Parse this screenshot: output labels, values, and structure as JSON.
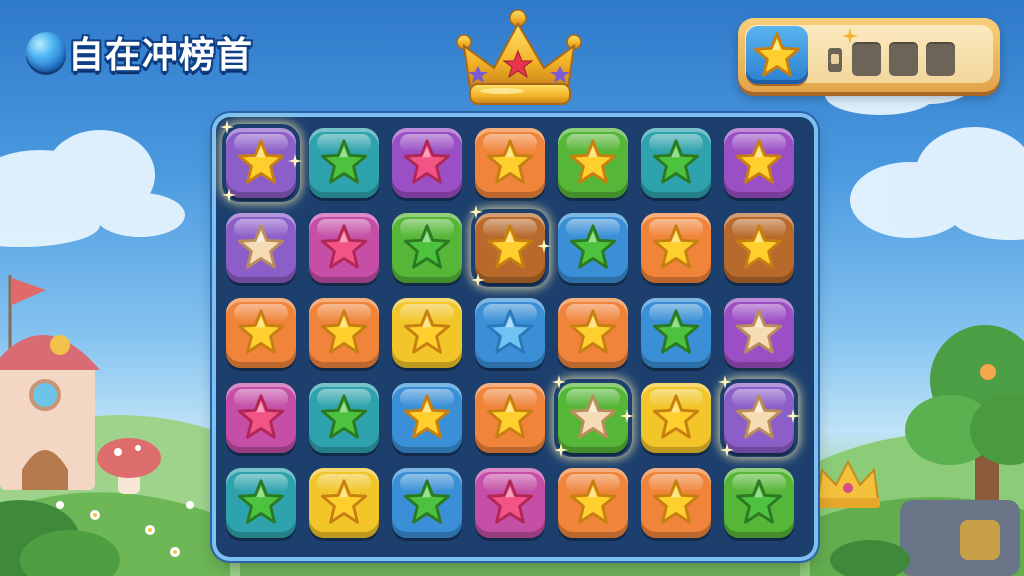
{
  "title": "自在冲榜首",
  "icons": {
    "title_orb": "blue-orb-icon",
    "crown": "gold-crown-icon",
    "score_star": "star-icon"
  },
  "colors": {
    "orange": "#f0843a",
    "teal": "#2fa3ad",
    "purple": "#9b4fc4",
    "green": "#56b637",
    "blue": "#3a8fd6",
    "lavender": "#8c5ec8",
    "magenta": "#c54fa6",
    "yellow": "#f2c529",
    "brown": "#b86a2c",
    "star_gold": "#ffcf2e",
    "star_green": "#4cc23e",
    "star_pink": "#f25486",
    "star_cream": "#f6dcb5",
    "star_blue": "#6fc3f2"
  },
  "board": {
    "rows": 5,
    "cols": 7,
    "tiles": [
      [
        {
          "bg": "lavender",
          "star": "gold",
          "sparkle": true
        },
        {
          "bg": "teal",
          "star": "green"
        },
        {
          "bg": "purple",
          "star": "pink"
        },
        {
          "bg": "orange",
          "star": "gold"
        },
        {
          "bg": "green",
          "star": "gold"
        },
        {
          "bg": "teal",
          "star": "green"
        },
        {
          "bg": "purple",
          "star": "gold"
        }
      ],
      [
        {
          "bg": "lavender",
          "star": "cream"
        },
        {
          "bg": "magenta",
          "star": "pink"
        },
        {
          "bg": "green",
          "star": "green"
        },
        {
          "bg": "brown",
          "star": "gold",
          "sparkle": true
        },
        {
          "bg": "blue",
          "star": "green"
        },
        {
          "bg": "orange",
          "star": "gold"
        },
        {
          "bg": "brown",
          "star": "gold"
        }
      ],
      [
        {
          "bg": "orange",
          "star": "gold"
        },
        {
          "bg": "orange",
          "star": "gold"
        },
        {
          "bg": "yellow",
          "star": "gold"
        },
        {
          "bg": "blue",
          "star": "blue"
        },
        {
          "bg": "orange",
          "star": "gold"
        },
        {
          "bg": "blue",
          "star": "green"
        },
        {
          "bg": "purple",
          "star": "cream"
        }
      ],
      [
        {
          "bg": "magenta",
          "star": "pink"
        },
        {
          "bg": "teal",
          "star": "green"
        },
        {
          "bg": "blue",
          "star": "gold"
        },
        {
          "bg": "orange",
          "star": "gold"
        },
        {
          "bg": "green",
          "star": "cream",
          "sparkle": true
        },
        {
          "bg": "yellow",
          "star": "gold"
        },
        {
          "bg": "lavender",
          "star": "cream",
          "sparkle": true
        }
      ],
      [
        {
          "bg": "teal",
          "star": "green"
        },
        {
          "bg": "yellow",
          "star": "gold"
        },
        {
          "bg": "blue",
          "star": "green"
        },
        {
          "bg": "magenta",
          "star": "pink"
        },
        {
          "bg": "orange",
          "star": "gold"
        },
        {
          "bg": "orange",
          "star": "gold"
        },
        {
          "bg": "green",
          "star": "green"
        }
      ]
    ]
  }
}
